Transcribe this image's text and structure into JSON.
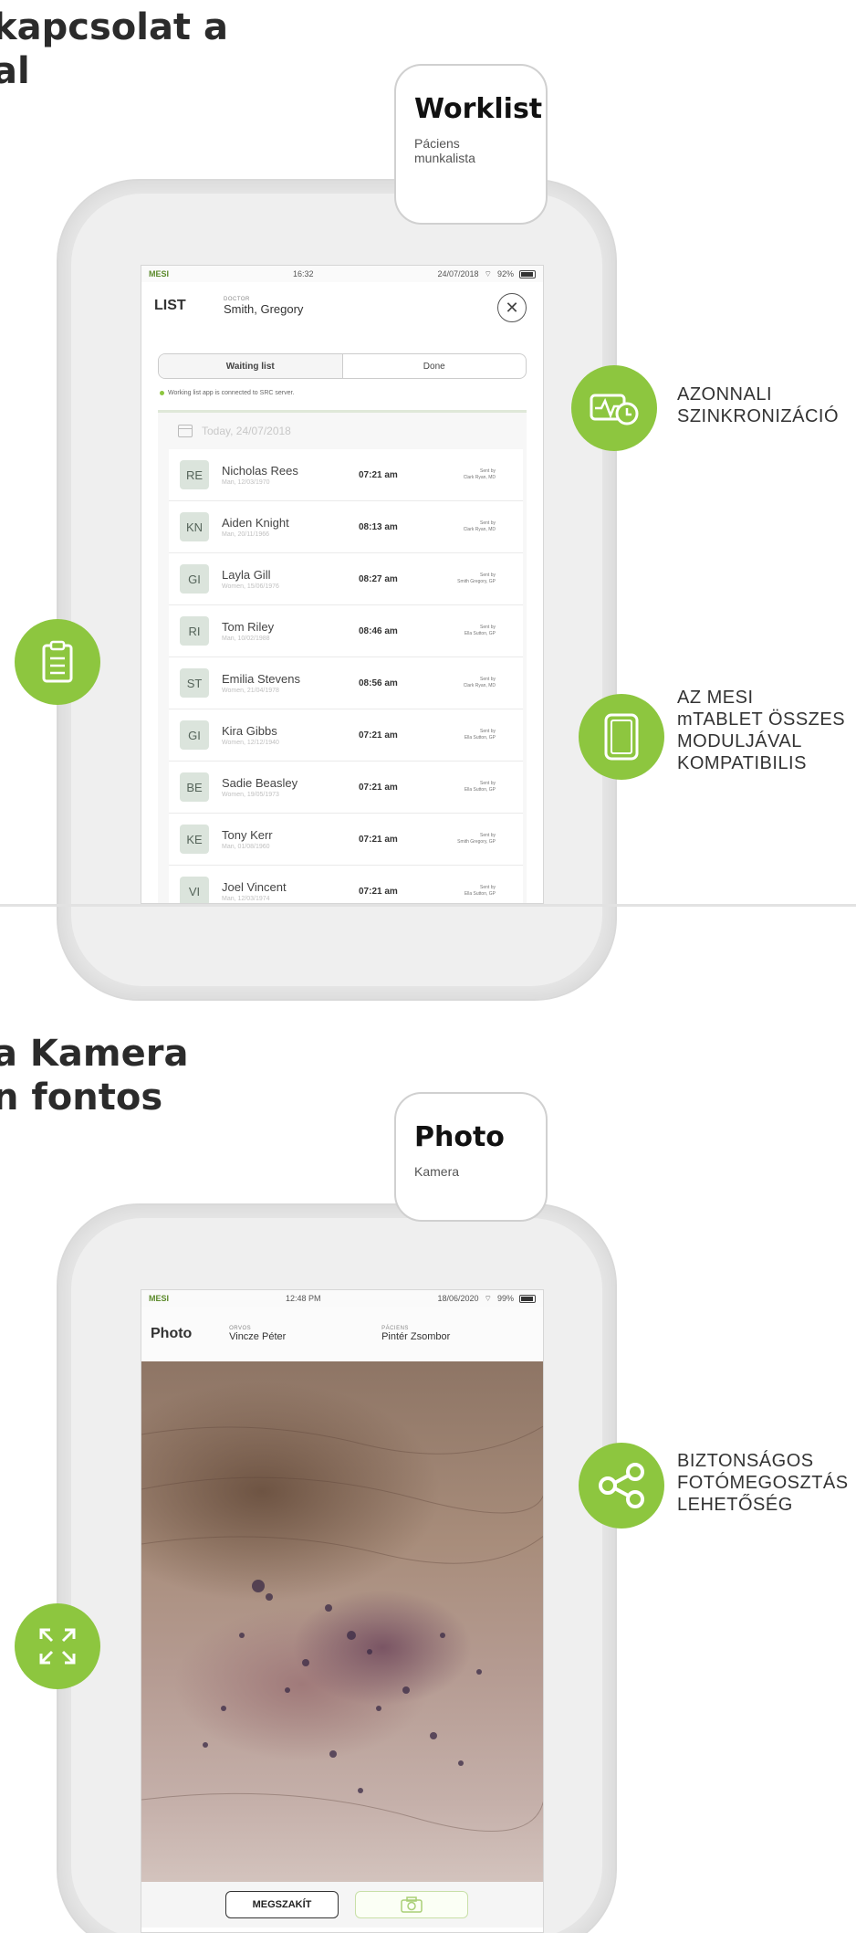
{
  "section1": {
    "heading": "kapcsolat a\nal",
    "card": {
      "title": "Worklist",
      "subtitle": "Páciens\nmunkalista"
    },
    "features": [
      {
        "icon": "sync-clock-icon",
        "label": "AZONNALI\nSZINKRONIZÁCIÓ"
      },
      {
        "icon": "tablet-icon",
        "label": "AZ MESI\nmTABLET ÖSSZES\nMODULJÁVAL\nKOMPATIBILIS"
      },
      {
        "icon": "clipboard-icon",
        "label": ""
      }
    ],
    "status": {
      "brand": "MESI",
      "time": "16:32",
      "date": "24/07/2018",
      "battery": "92%"
    },
    "screen_title": "LIST",
    "doctor_label": "DOCTOR",
    "doctor_name": "Smith, Gregory",
    "tabs": [
      {
        "label": "Waiting list",
        "active": true
      },
      {
        "label": "Done",
        "active": false
      }
    ],
    "connected_text": "Working list app is connected to SRC server.",
    "date_text": "Today, 24/07/2018",
    "patients": [
      {
        "initials": "RE",
        "name": "Nicholas Rees",
        "meta": "Man, 12/03/1970",
        "time": "07:21 am",
        "sent": "Sent by\nClark Ryan, MD"
      },
      {
        "initials": "KN",
        "name": "Aiden Knight",
        "meta": "Man, 20/11/1966",
        "time": "08:13 am",
        "sent": "Sent by\nClark Ryan, MD"
      },
      {
        "initials": "GI",
        "name": "Layla Gill",
        "meta": "Women, 15/06/1976",
        "time": "08:27 am",
        "sent": "Sent by\nSmith Gregory, GP"
      },
      {
        "initials": "RI",
        "name": "Tom Riley",
        "meta": "Man, 10/02/1988",
        "time": "08:46 am",
        "sent": "Sent by\nElla Sutton, GP"
      },
      {
        "initials": "ST",
        "name": "Emilia Stevens",
        "meta": "Women, 21/04/1978",
        "time": "08:56 am",
        "sent": "Sent by\nClark Ryan, MD"
      },
      {
        "initials": "GI",
        "name": "Kira Gibbs",
        "meta": "Women, 12/12/1940",
        "time": "07:21 am",
        "sent": "Sent by\nElla Sutton, GP"
      },
      {
        "initials": "BE",
        "name": "Sadie Beasley",
        "meta": "Women, 19/05/1973",
        "time": "07:21 am",
        "sent": "Sent by\nElla Sutton, GP"
      },
      {
        "initials": "KE",
        "name": "Tony Kerr",
        "meta": "Man, 01/08/1960",
        "time": "07:21 am",
        "sent": "Sent by\nSmith Gregory, GP"
      },
      {
        "initials": "VI",
        "name": "Joel Vincent",
        "meta": "Man, 12/03/1974",
        "time": "07:21 am",
        "sent": "Sent by\nElla Sutton, GP"
      }
    ]
  },
  "section2": {
    "heading": "a Kamera\nn fontos",
    "card": {
      "title": "Photo",
      "subtitle": "Kamera"
    },
    "features": [
      {
        "icon": "share-icon",
        "label": "BIZTONSÁGOS\nFOTÓMEGOSZTÁS\nLEHETŐSÉG"
      },
      {
        "icon": "expand-icon",
        "label": ""
      }
    ],
    "status": {
      "brand": "MESI",
      "time": "12:48 PM",
      "date": "18/06/2020",
      "battery": "99%"
    },
    "screen_title": "Photo",
    "doctor_label": "ORVOS",
    "doctor_name": "Vincze Péter",
    "patient_label": "PÁCIENS",
    "patient_name": "Pintér Zsombor",
    "stop_label": "MEGSZAKÍT"
  },
  "colors": {
    "accent": "#8dc63f",
    "frame": "#e6e6e6"
  }
}
